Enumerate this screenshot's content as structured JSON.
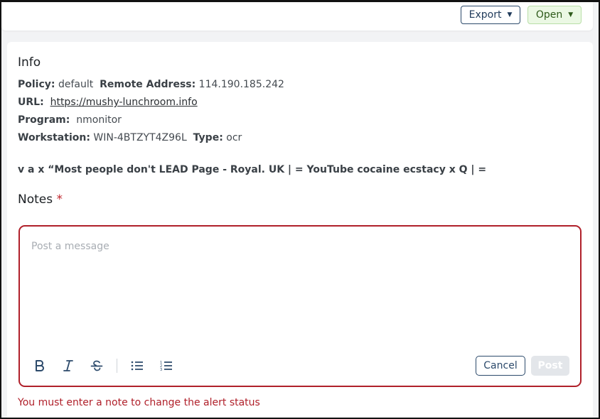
{
  "toolbar": {
    "export_label": "Export",
    "open_label": "Open"
  },
  "info": {
    "title": "Info",
    "policy_label": "Policy:",
    "policy_value": "default",
    "remote_label": "Remote Address:",
    "remote_value": "114.190.185.242",
    "url_label": "URL:",
    "url_value": "https://mushy-lunchroom.info",
    "program_label": "Program:",
    "program_value": "nmonitor",
    "workstation_label": "Workstation:",
    "workstation_value": "WIN-4BTZYT4Z96L",
    "type_label": "Type:",
    "type_value": "ocr",
    "ocr_text": "v a x “Most people don't LEAD Page - Royal. UK | = YouTube cocaine ecstacy x Q | ="
  },
  "notes": {
    "title": "Notes",
    "required_marker": "*",
    "placeholder": "Post a message",
    "cancel_label": "Cancel",
    "post_label": "Post",
    "error_message": "You must enter a note to change the alert status"
  },
  "icons": {
    "export_caret": "caret-down-icon",
    "open_caret": "caret-down-icon",
    "bold": "bold-icon",
    "italic": "italic-icon",
    "strike": "strikethrough-icon",
    "bullets": "bullet-list-icon",
    "numbered": "numbered-list-icon"
  },
  "colors": {
    "error": "#b0202a",
    "primary": "#2c4a6b",
    "open_bg": "#ebf8e4"
  }
}
